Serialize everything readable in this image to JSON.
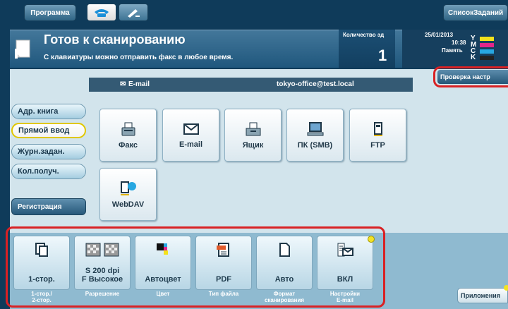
{
  "toolbar": {
    "program_label": "Программа",
    "job_list_label": "СписокЗаданий"
  },
  "header": {
    "title": "Готов к сканированию",
    "subtitle": "С клавиатуры можно отправить факс в любое время.",
    "copies_label": "Количество эд",
    "copies_value": "1",
    "date": "25/01/2013",
    "time": "10:38",
    "memory_label": "Память",
    "toner_letters": [
      "Y",
      "M",
      "C",
      "K"
    ],
    "check_settings_label": "Проверка настр"
  },
  "emailbar": {
    "label": "E-mail",
    "address": "tokyo-office@test.local"
  },
  "sidebar": {
    "items": [
      {
        "label": "Адр. книга"
      },
      {
        "label": "Прямой ввод"
      },
      {
        "label": "Журн.задан."
      },
      {
        "label": "Кол.получ."
      },
      {
        "label": "Регистрация"
      }
    ]
  },
  "destinations": [
    {
      "label": "Факс",
      "icon": "fax-icon"
    },
    {
      "label": "E-mail",
      "icon": "mail-icon"
    },
    {
      "label": "Ящик",
      "icon": "box-icon"
    },
    {
      "label": "ПК (SMB)",
      "icon": "pc-icon"
    },
    {
      "label": "FTP",
      "icon": "ftp-icon"
    },
    {
      "label": "WebDAV",
      "icon": "webdav-icon"
    }
  ],
  "settings": [
    {
      "value": "1-стор.",
      "caption": "1-стор./\n2-стор."
    },
    {
      "value": "S 200 dpi\nF Высокое",
      "caption": "Разрешение"
    },
    {
      "value": "Автоцвет",
      "caption": "Цвет"
    },
    {
      "value": "PDF",
      "caption": "Тип файла"
    },
    {
      "value": "Авто",
      "caption": "Формат\nсканирования"
    },
    {
      "value": "ВКЛ",
      "caption": "Настройки\nE-mail"
    }
  ],
  "apps_label": "Приложения",
  "colors": {
    "toner_y": "#f3e21c",
    "toner_m": "#e2258a",
    "toner_c": "#27a7e1",
    "toner_k": "#222222",
    "highlight": "#d92124"
  }
}
